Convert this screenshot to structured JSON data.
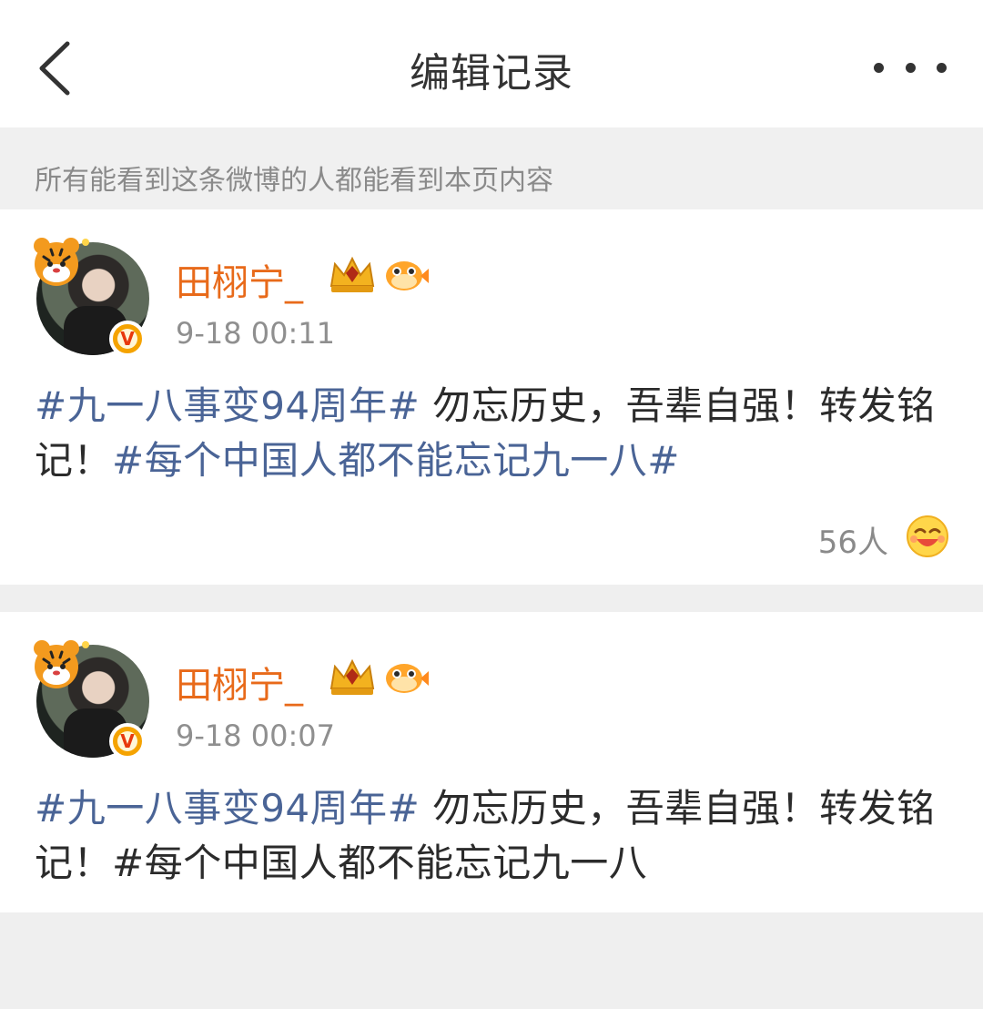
{
  "header": {
    "title": "编辑记录",
    "back_icon": "chevron-left-icon",
    "more_icon": "more-horizontal-icon"
  },
  "notice": {
    "text": "所有能看到这条微博的人都能看到本页内容"
  },
  "records": [
    {
      "username": "田栩宁_",
      "timestamp": "9-18 00:11",
      "content": {
        "tag1": "#九一八事变94周年#",
        "mid": " 勿忘历史，吾辈自强！转发铭记！",
        "tag2": "#每个中国人都不能忘记九一八#"
      },
      "likes": "56人",
      "verified_badge": "V"
    },
    {
      "username": "田栩宁_",
      "timestamp": "9-18 00:07",
      "content": {
        "tag1": "#九一八事变94周年#",
        "mid": " 勿忘历史，吾辈自强！转发铭记！#每个中国人都不能忘记九一八"
      },
      "verified_badge": "V"
    }
  ],
  "colors": {
    "username": "#e86a1a",
    "hashtag": "#4a6496",
    "meta": "#8f8f8f",
    "page_bg": "#efefef",
    "verified": "#f5a300"
  }
}
